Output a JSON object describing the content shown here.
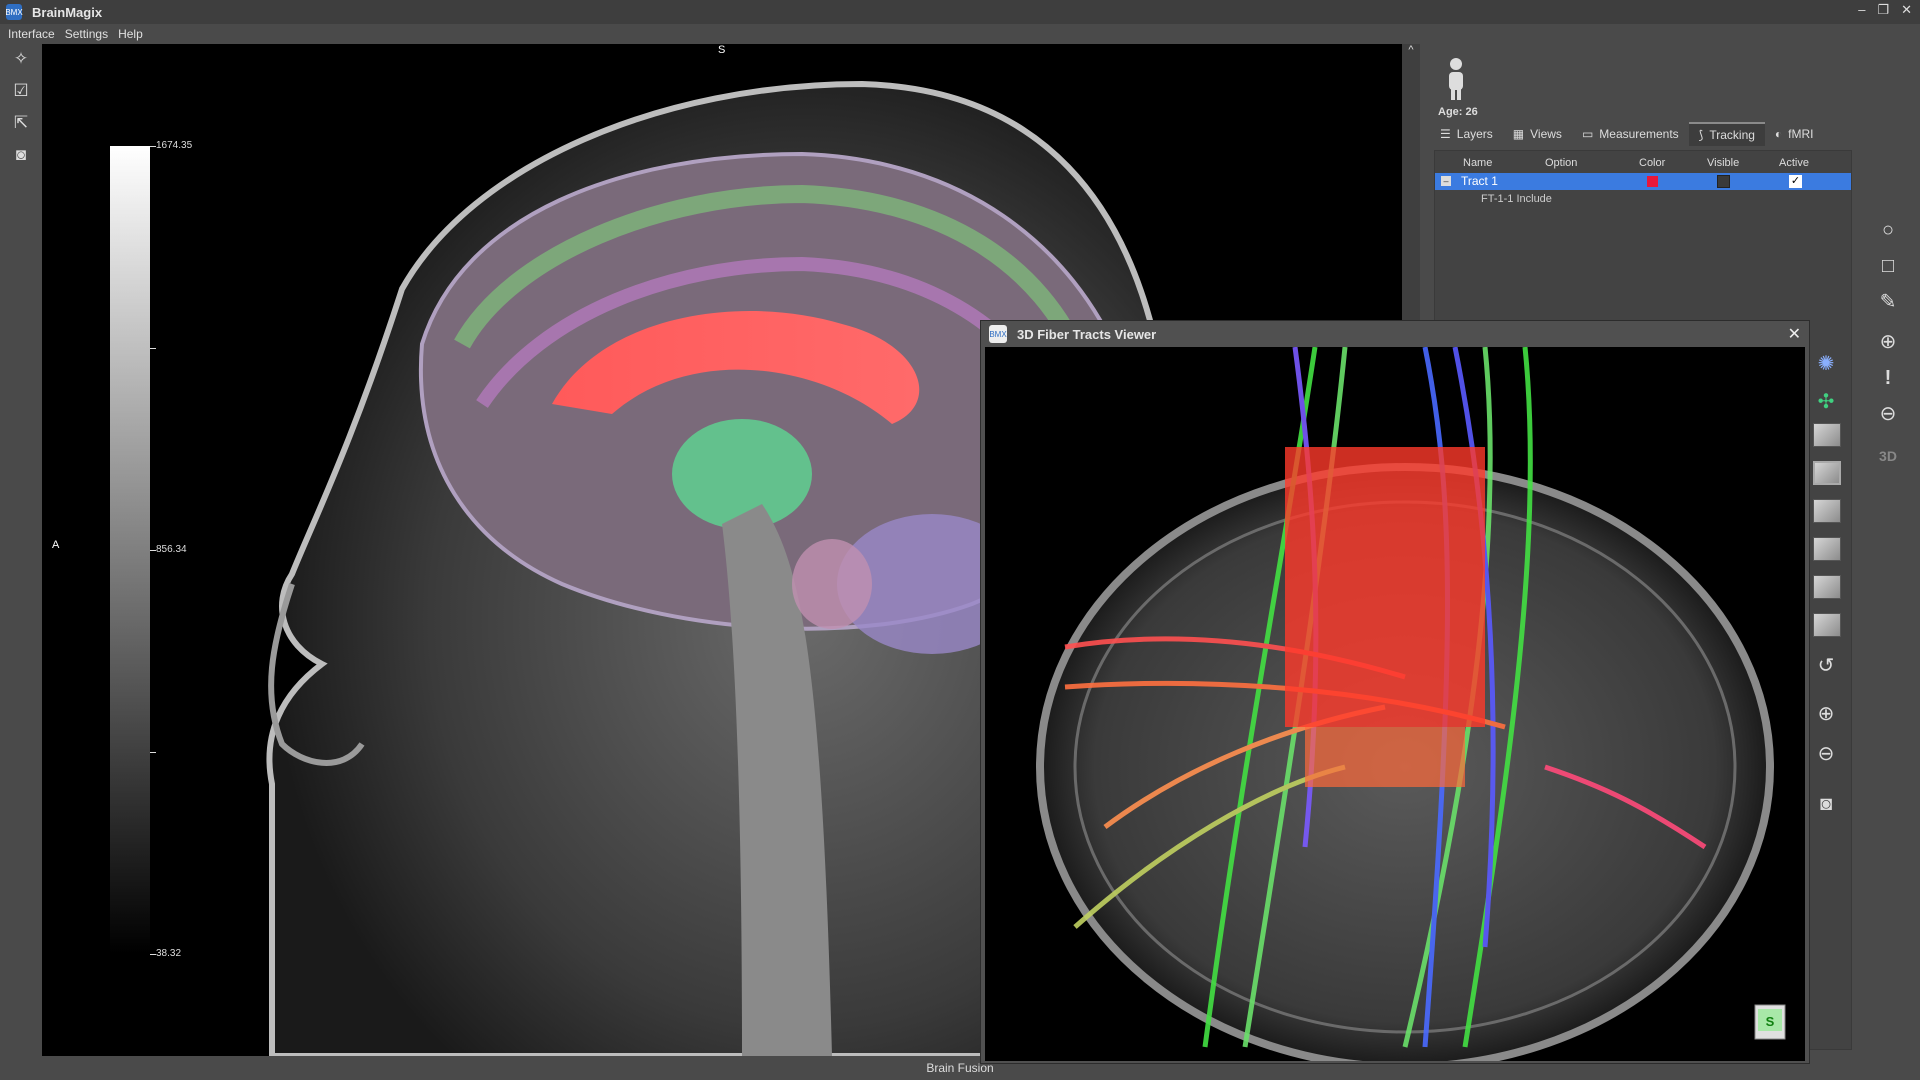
{
  "app": {
    "title": "BrainMagix",
    "logo_text": "BMX"
  },
  "window_controls": {
    "minimize": "–",
    "maximize": "❐",
    "close": "✕"
  },
  "menu": [
    "Interface",
    "Settings",
    "Help"
  ],
  "left_toolbar": [
    {
      "icon": "magic-wand-icon",
      "glyph": "✧"
    },
    {
      "icon": "checkbox-icon",
      "glyph": "☑"
    },
    {
      "icon": "export-icon",
      "glyph": "⇱"
    },
    {
      "icon": "camera-icon",
      "glyph": "◙"
    }
  ],
  "main_view": {
    "orientation_top": "S",
    "orientation_left": "A",
    "colorbar": {
      "max": "1674.35",
      "mid": "856.34",
      "min": "38.32"
    }
  },
  "patient": {
    "age_label": "Age: 26"
  },
  "tabs": [
    {
      "label": "Layers",
      "icon": "list-icon",
      "glyph": "☰"
    },
    {
      "label": "Views",
      "icon": "grid-icon",
      "glyph": "▦"
    },
    {
      "label": "Measurements",
      "icon": "ruler-icon",
      "glyph": "▭"
    },
    {
      "label": "Tracking",
      "icon": "tracking-icon",
      "glyph": "⟆",
      "active": true
    },
    {
      "label": "fMRI",
      "icon": "brain-icon",
      "glyph": "◐"
    }
  ],
  "tract_table": {
    "headers": [
      "Name",
      "Option",
      "Color",
      "Visible",
      "Active"
    ],
    "rows": [
      {
        "expander": "–",
        "name": "Tract 1",
        "color": "#e8183a",
        "visible": false,
        "active": true,
        "active_mark": "✓",
        "children": [
          "FT-1-1 Include"
        ]
      }
    ]
  },
  "right_toolbar": [
    {
      "icon": "circle-roi-icon",
      "glyph": "○"
    },
    {
      "icon": "square-roi-icon",
      "glyph": "□"
    },
    {
      "icon": "pencil-icon",
      "glyph": "✎"
    },
    {
      "icon": "add-icon",
      "glyph": "⊕"
    },
    {
      "icon": "exclamation-icon",
      "glyph": "!"
    },
    {
      "icon": "remove-icon",
      "glyph": "⊖"
    },
    {
      "icon": "3d-icon",
      "glyph": "3D"
    }
  ],
  "status": {
    "text": "Brain Fusion"
  },
  "popup": {
    "title": "3D Fiber Tracts Viewer",
    "close": "✕",
    "orientation_cube_label": "S",
    "tools": [
      {
        "icon": "brain-render-icon",
        "glyph": "✺"
      },
      {
        "icon": "axes-icon",
        "glyph": "✣"
      },
      {
        "icon": "cube-view-icon"
      },
      {
        "icon": "cube-view-icon"
      },
      {
        "icon": "cube-view-icon"
      },
      {
        "icon": "cube-view-icon"
      },
      {
        "icon": "cube-view-icon"
      },
      {
        "icon": "cube-view-icon"
      },
      {
        "icon": "reset-icon",
        "glyph": "↺"
      },
      {
        "icon": "zoom-in-icon",
        "glyph": "⊕"
      },
      {
        "icon": "zoom-out-icon",
        "glyph": "⊖"
      },
      {
        "icon": "camera-icon",
        "glyph": "◙"
      }
    ]
  },
  "colors": {
    "selection": "#3b7be0",
    "tract_color": "#e8183a"
  }
}
